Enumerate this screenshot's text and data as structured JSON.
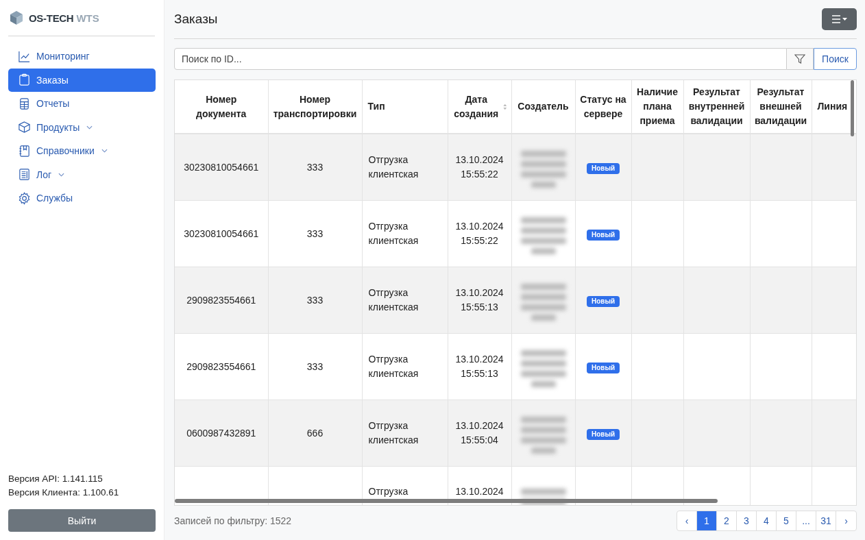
{
  "sidebar": {
    "logo": {
      "brand": "OS-TECH",
      "product": "WTS"
    },
    "items": [
      {
        "label": "Мониторинг",
        "selected": false,
        "has_submenu": false
      },
      {
        "label": "Заказы",
        "selected": true,
        "has_submenu": false
      },
      {
        "label": "Отчеты",
        "selected": false,
        "has_submenu": false
      },
      {
        "label": "Продукты",
        "selected": false,
        "has_submenu": true
      },
      {
        "label": "Справочники",
        "selected": false,
        "has_submenu": true
      },
      {
        "label": "Лог",
        "selected": false,
        "has_submenu": true
      },
      {
        "label": "Службы",
        "selected": false,
        "has_submenu": false
      }
    ],
    "versions": [
      "Версия API: 1.141.115",
      "Версия Клиента: 1.100.61"
    ],
    "logout_button": "Выйти"
  },
  "page": {
    "title": "Заказы"
  },
  "search": {
    "placeholder": "Поиск по ID...",
    "button": "Поиск"
  },
  "table": {
    "columns": [
      {
        "label": "Номер документа",
        "sortable": false
      },
      {
        "label": "Номер транспортировки",
        "sortable": false
      },
      {
        "label": "Тип",
        "sortable": false
      },
      {
        "label": "Дата создания",
        "sortable": true
      },
      {
        "label": "Создатель",
        "sortable": false
      },
      {
        "label": "Статус на сервере",
        "sortable": false
      },
      {
        "label": "Наличие плана приема",
        "sortable": false
      },
      {
        "label": "Результат внутренней валидации",
        "sortable": false
      },
      {
        "label": "Результат внешней валидации",
        "sortable": false
      },
      {
        "label": "Линия",
        "sortable": false
      }
    ],
    "rows": [
      {
        "doc": "30230810054661",
        "transport": "333",
        "type": "Отгрузка клиентская",
        "created": "13.10.2024 15:55:22",
        "status": "Новый"
      },
      {
        "doc": "30230810054661",
        "transport": "333",
        "type": "Отгрузка клиентская",
        "created": "13.10.2024 15:55:22",
        "status": "Новый"
      },
      {
        "doc": "2909823554661",
        "transport": "333",
        "type": "Отгрузка клиентская",
        "created": "13.10.2024 15:55:13",
        "status": "Новый"
      },
      {
        "doc": "2909823554661",
        "transport": "333",
        "type": "Отгрузка клиентская",
        "created": "13.10.2024 15:55:13",
        "status": "Новый"
      },
      {
        "doc": "0600987432891",
        "transport": "666",
        "type": "Отгрузка клиентская",
        "created": "13.10.2024 15:55:04",
        "status": "Новый"
      },
      {
        "type": "Отгрузка",
        "created": "13.10.2024"
      }
    ]
  },
  "footer": {
    "records": "Записей по фильтру: 1522"
  },
  "pagination": [
    {
      "label": "‹",
      "selected": false
    },
    {
      "label": "1",
      "selected": true
    },
    {
      "label": "2",
      "selected": false
    },
    {
      "label": "3",
      "selected": false
    },
    {
      "label": "4",
      "selected": false
    },
    {
      "label": "5",
      "selected": false
    },
    {
      "label": "...",
      "selected": false
    },
    {
      "label": "31",
      "selected": false
    },
    {
      "label": "›",
      "selected": false
    }
  ]
}
